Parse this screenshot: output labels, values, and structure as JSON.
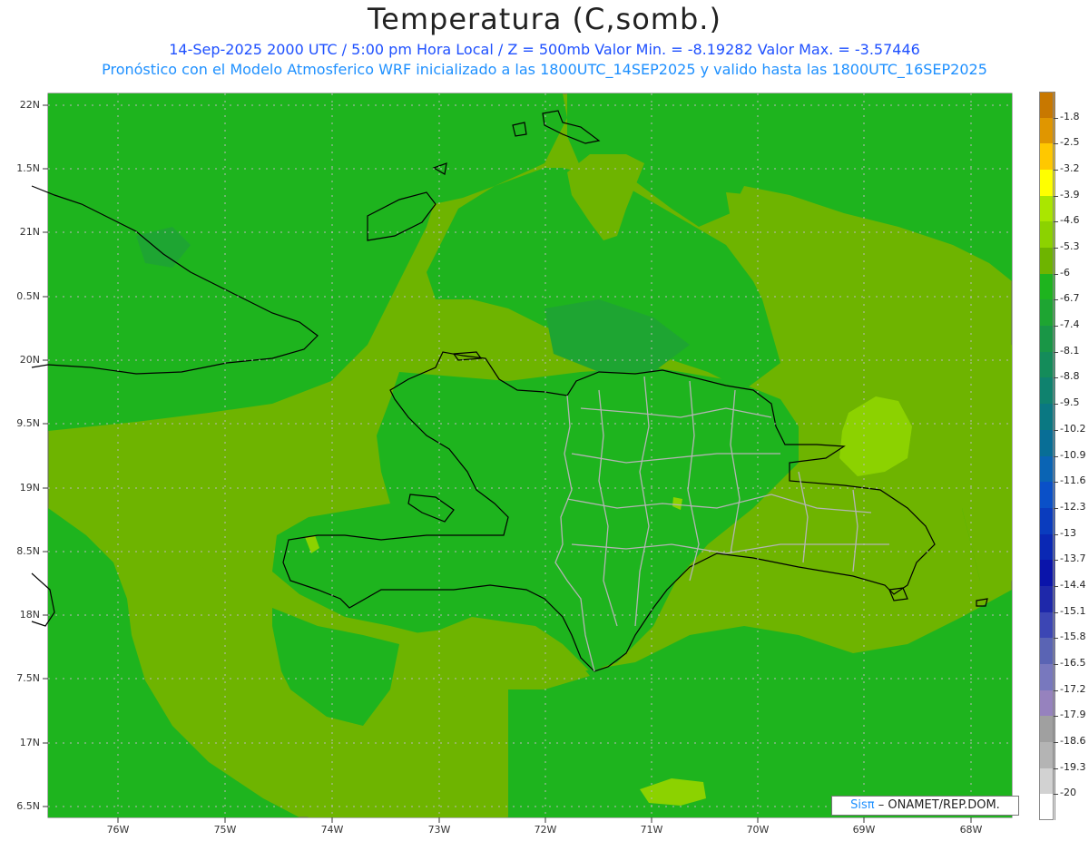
{
  "header": {
    "title": "Temperatura (C,somb.)",
    "line1": "14-Sep-2025  2000 UTC / 5:00 pm Hora Local / Z = 500mb  Valor Min. = -8.19282  Valor Max. = -3.57446",
    "line2": "Pronóstico con el Modelo Atmosferico WRF inicializado a las 1800UTC_14SEP2025 y valido hasta las  1800UTC_16SEP2025"
  },
  "axes": {
    "lat_labels": [
      "22N",
      "1.5N",
      "21N",
      "0.5N",
      "20N",
      "9.5N",
      "19N",
      "8.5N",
      "18N",
      "7.5N",
      "17N",
      "6.5N"
    ],
    "lon_labels": [
      "76W",
      "75W",
      "74W",
      "73W",
      "72W",
      "71W",
      "70W",
      "69W",
      "68W"
    ]
  },
  "colorbar": {
    "labels": [
      "-1.8",
      "-2.5",
      "-3.2",
      "-3.9",
      "-4.6",
      "-5.3",
      "-6",
      "-6.7",
      "-7.4",
      "-8.1",
      "-8.8",
      "-9.5",
      "-10.2",
      "-10.9",
      "-11.6",
      "-12.3",
      "-13",
      "-13.7",
      "-14.4",
      "-15.1",
      "-15.8",
      "-16.5",
      "-17.2",
      "-17.9",
      "-18.6",
      "-19.3",
      "-20"
    ],
    "colors": [
      "#c87800",
      "#e09600",
      "#ffc800",
      "#ffff00",
      "#aae600",
      "#8cd200",
      "#6eb400",
      "#1eb41e",
      "#1ea532",
      "#199646",
      "#148c5a",
      "#0f826e",
      "#0a7882",
      "#086e96",
      "#0a64b4",
      "#0a50c8",
      "#0a3cbe",
      "#0a28b4",
      "#0a14aa",
      "#1e28aa",
      "#3c46b4",
      "#5a64b4",
      "#7878be",
      "#9682be",
      "#a0a0a0",
      "#b4b4b4",
      "#d2d2d2",
      "#ffffff"
    ]
  },
  "map_colors": {
    "background": "#6eb400",
    "cool": "#1eb41e",
    "cooler": "#1ea532",
    "warm": "#8cd200",
    "coast": "#000000",
    "border": "#b4b4b4",
    "grid": "#b9b9b9"
  },
  "credit": {
    "sis": "Sisπ",
    "rest": "– ONAMET/REP.DOM."
  }
}
